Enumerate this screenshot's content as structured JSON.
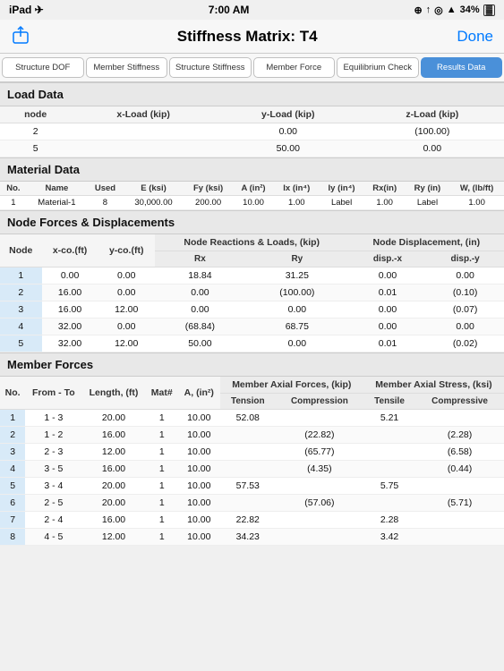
{
  "statusBar": {
    "left": "iPad ✈",
    "center": "7:00 AM",
    "right": "⊕ ↑ ◎ ▲ 34%"
  },
  "header": {
    "title": "Stiffness Matrix: T4",
    "doneLabel": "Done"
  },
  "tabs": [
    {
      "id": "structure-dof",
      "label": "Structure DOF",
      "active": false
    },
    {
      "id": "member-stiffness",
      "label": "Member Stiffness",
      "active": false
    },
    {
      "id": "structure-stiffness",
      "label": "Structure Stiffness",
      "active": false
    },
    {
      "id": "member-force",
      "label": "Member Force",
      "active": false
    },
    {
      "id": "equilibrium-check",
      "label": "Equilibrium Check",
      "active": false
    },
    {
      "id": "results-data",
      "label": "Results Data",
      "active": true
    }
  ],
  "loadData": {
    "sectionTitle": "Load Data",
    "headers": [
      "node",
      "x-Load (kip)",
      "y-Load (kip)",
      "z-Load (kip)"
    ],
    "rows": [
      [
        "2",
        "",
        "0.00",
        "(100.00)"
      ],
      [
        "5",
        "",
        "50.00",
        "0.00"
      ]
    ]
  },
  "materialData": {
    "sectionTitle": "Material Data",
    "headers": [
      "No.",
      "Name",
      "Used",
      "E (ksi)",
      "Fy (ksi)",
      "A (in²)",
      "Ix (in⁴)",
      "Iy (in⁴)",
      "Rx(in)",
      "Ry (in)",
      "W, (lb/ft)"
    ],
    "rows": [
      [
        "1",
        "Material-1",
        "8",
        "30,000.00",
        "200.00",
        "10.00",
        "1.00",
        "Label",
        "1.00",
        "Label",
        "1.00"
      ]
    ]
  },
  "nodeForces": {
    "sectionTitle": "Node Forces & Displacements",
    "colHeaders": [
      "Node",
      "x-co.(ft)",
      "y-co.(ft)",
      "Rx",
      "Ry",
      "disp.-x",
      "disp.-y"
    ],
    "groupHeaders": {
      "reactions": "Node Reactions & Loads, (kip)",
      "displacements": "Node Displacement, (in)"
    },
    "rows": [
      [
        "1",
        "0.00",
        "0.00",
        "18.84",
        "31.25",
        "0.00",
        "0.00"
      ],
      [
        "2",
        "16.00",
        "0.00",
        "0.00",
        "(100.00)",
        "0.01",
        "(0.10)"
      ],
      [
        "3",
        "16.00",
        "12.00",
        "0.00",
        "0.00",
        "0.00",
        "(0.07)"
      ],
      [
        "4",
        "32.00",
        "0.00",
        "(68.84)",
        "68.75",
        "0.00",
        "0.00"
      ],
      [
        "5",
        "32.00",
        "12.00",
        "50.00",
        "0.00",
        "0.01",
        "(0.02)"
      ]
    ]
  },
  "memberForces": {
    "sectionTitle": "Member Forces",
    "colHeaders": [
      "No.",
      "From - To",
      "Length, (ft)",
      "Mat#",
      "A, (in²)",
      "Tension",
      "Compression",
      "Tensile",
      "Compressive"
    ],
    "groupHeaders": {
      "axialForces": "Member Axial Forces, (kip)",
      "axialStress": "Member Axial Stress, (ksi)"
    },
    "rows": [
      [
        "1",
        "1 - 3",
        "20.00",
        "1",
        "10.00",
        "52.08",
        "",
        "5.21",
        ""
      ],
      [
        "2",
        "1 - 2",
        "16.00",
        "1",
        "10.00",
        "",
        "(22.82)",
        "",
        "(2.28)"
      ],
      [
        "3",
        "2 - 3",
        "12.00",
        "1",
        "10.00",
        "",
        "(65.77)",
        "",
        "(6.58)"
      ],
      [
        "4",
        "3 - 5",
        "16.00",
        "1",
        "10.00",
        "",
        "(4.35)",
        "",
        "(0.44)"
      ],
      [
        "5",
        "3 - 4",
        "20.00",
        "1",
        "10.00",
        "57.53",
        "",
        "5.75",
        ""
      ],
      [
        "6",
        "2 - 5",
        "20.00",
        "1",
        "10.00",
        "",
        "(57.06)",
        "",
        "(5.71)"
      ],
      [
        "7",
        "2 - 4",
        "16.00",
        "1",
        "10.00",
        "22.82",
        "",
        "2.28",
        ""
      ],
      [
        "8",
        "4 - 5",
        "12.00",
        "1",
        "10.00",
        "34.23",
        "",
        "3.42",
        ""
      ]
    ]
  }
}
